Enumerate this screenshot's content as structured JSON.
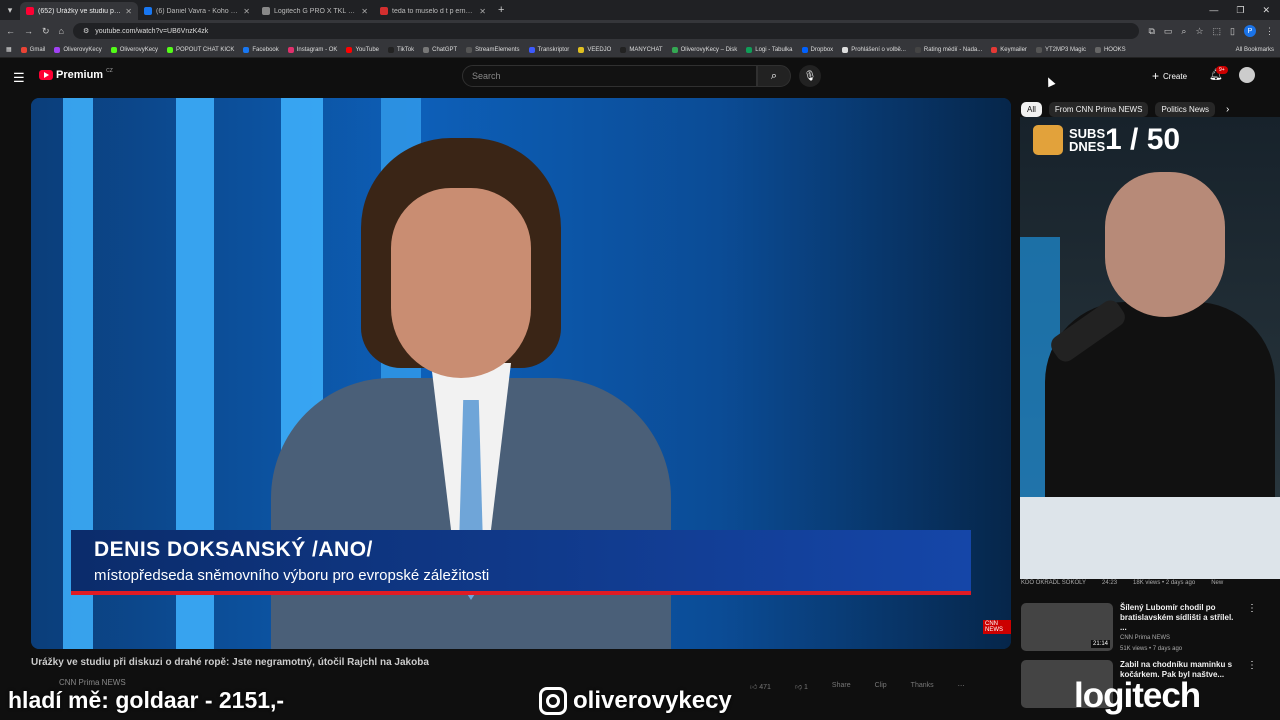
{
  "browser": {
    "tabs": [
      {
        "title": "(652) Urážky ve studiu při d",
        "active": true,
        "color": "#ff0033"
      },
      {
        "title": "(6) Daniel Vavra - Koho číst a sl",
        "active": false,
        "color": "#1877f2"
      },
      {
        "title": "Logitech G PRO X TKL LIGHTSP",
        "active": false,
        "color": "#888888"
      },
      {
        "title": "teda to muselo d t p ernou pr",
        "active": false,
        "color": "#d32f2f"
      }
    ],
    "url": "youtube.com/watch?v=UB6VnzK4zk",
    "bookmarks": [
      {
        "label": "Gmail",
        "color": "#ea4335"
      },
      {
        "label": "OliverovyKecy",
        "color": "#a142f4"
      },
      {
        "label": "OliverovyKecy",
        "color": "#53fc18"
      },
      {
        "label": "POPOUT CHAT KICK",
        "color": "#53fc18"
      },
      {
        "label": "Facebook",
        "color": "#1877f2"
      },
      {
        "label": "Instagram - OK",
        "color": "#e1306c"
      },
      {
        "label": "YouTube",
        "color": "#ff0000"
      },
      {
        "label": "TikTok",
        "color": "#222222"
      },
      {
        "label": "ChatGPT",
        "color": "#777777"
      },
      {
        "label": "StreamElements",
        "color": "#555555"
      },
      {
        "label": "Transkriptor",
        "color": "#3d5afe"
      },
      {
        "label": "VEEDJO",
        "color": "#e0c020"
      },
      {
        "label": "MANYCHAT",
        "color": "#222222"
      },
      {
        "label": "OliverovyKecy – Disk",
        "color": "#34a853"
      },
      {
        "label": "Logi - Tabulka",
        "color": "#0f9d58"
      },
      {
        "label": "Dropbox",
        "color": "#0061ff"
      },
      {
        "label": "Prohlášení o volbě...",
        "color": "#dddddd"
      },
      {
        "label": "Rating médií - Nada...",
        "color": "#444444"
      },
      {
        "label": "Keymailer",
        "color": "#e53935"
      },
      {
        "label": "YT2MP3 Magic",
        "color": "#555555"
      },
      {
        "label": "HOOKS",
        "color": "#666666"
      }
    ],
    "all_bookmarks": "All Bookmarks"
  },
  "youtube": {
    "logo_text": "Premium",
    "logo_country": "CZ",
    "search_placeholder": "Search",
    "create_label": "Create",
    "notif_count": "9+",
    "chips": [
      "All",
      "From CNN Prima NEWS",
      "Politics News"
    ],
    "video_title": "Urážky ve studiu při diskuzi o drahé ropě: Jste negramotný, útočil Rajchl na Jakoba",
    "channel": "CNN Prima NEWS",
    "actions": [
      "471",
      "1",
      "Share",
      "Clip",
      "Thanks"
    ]
  },
  "video": {
    "lower_third_name": "DENIS DOKSANSKÝ /ANO/",
    "lower_third_role": "místopředseda sněmovního výboru pro evropské záležitosti",
    "channel_bug": "CNN NEWS"
  },
  "stream": {
    "subs_label": "SUBS DNES",
    "subs_count": "1 / 50",
    "overlay_left": "hladí mě: goldaar - 2151,-",
    "overlay_ig": "oliverovykecy",
    "sponsor": "logitech"
  },
  "related": [
    {
      "title": "KDO OKRADL SOKOLY",
      "duration": "24:23",
      "channel": "",
      "views": "18K views • 2 days ago",
      "badge": "New"
    },
    {
      "title": "Šílený Lubomír chodil po bratislavském sídlišti a střílel. ...",
      "duration": "21:14",
      "channel": "CNN Prima NEWS",
      "views": "51K views • 7 days ago",
      "badge": ""
    },
    {
      "title": "Zabil na chodníku maminku s kočárkem. Pak byl naštve...",
      "duration": "",
      "channel": "",
      "views": "",
      "badge": ""
    }
  ]
}
